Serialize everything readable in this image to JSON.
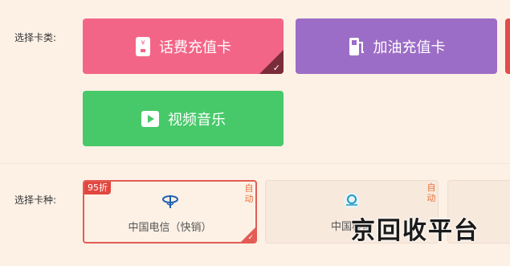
{
  "card_category": {
    "label": "选择卡类:",
    "options": [
      {
        "label": "话费充值卡",
        "icon": "phone-card-icon",
        "color": "#f36587",
        "selected": true
      },
      {
        "label": "加油充值卡",
        "icon": "fuel-pump-icon",
        "color": "#9c6dc6",
        "selected": false
      },
      {
        "label": "视频音乐",
        "icon": "video-play-icon",
        "color": "#47c96a",
        "selected": false
      }
    ]
  },
  "card_kind": {
    "label": "选择卡种:",
    "options": [
      {
        "name": "中国电信（快销）",
        "discount": "95折",
        "auto": "自动",
        "icon": "china-telecom-logo-icon",
        "selected": true
      },
      {
        "name": "中国移动",
        "auto": "自动",
        "icon": "china-mobile-logo-icon",
        "selected": false
      }
    ]
  },
  "watermark": "京回收平台"
}
